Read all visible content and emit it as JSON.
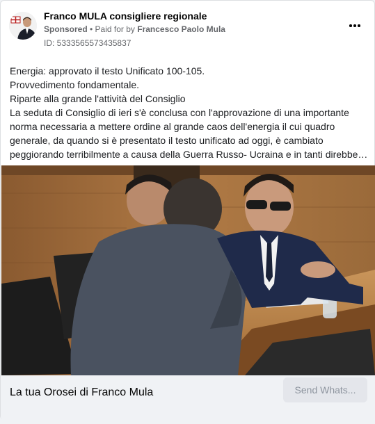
{
  "header": {
    "page_name": "Franco MULA consigliere regionale",
    "sponsored": "Sponsored",
    "separator": " • ",
    "paid_for_prefix": "Paid for by ",
    "paid_for_name": "Francesco Paolo Mula",
    "ad_id": "ID: 5333565573435837",
    "more_icon": "more-horizontal-icon"
  },
  "post": {
    "lines": [
      "Energia: approvato il testo Unificato 100-105.",
      "Provvedimento fondamentale.",
      "Riparte alla grande l'attività del Consiglio",
      "La seduta di Consiglio di ieri s'è conclusa con l'approvazione di una importante",
      "norma necessaria a mettere ordine al grande caos dell'energia il cui quadro",
      "generale, da quando si è presentato il testo unificato ad oggi, è cambiato",
      "peggiorando terribilmente a causa della Guerra Russo- Ucraina e in tanti direbber..."
    ]
  },
  "footer": {
    "title": "La tua Orosei di Franco Mula",
    "cta": "Send Whats..."
  },
  "colors": {
    "secondary_text": "#65676b",
    "footer_bg": "#f0f2f5",
    "button_bg": "#e4e6eb",
    "button_text": "#8d949e"
  }
}
